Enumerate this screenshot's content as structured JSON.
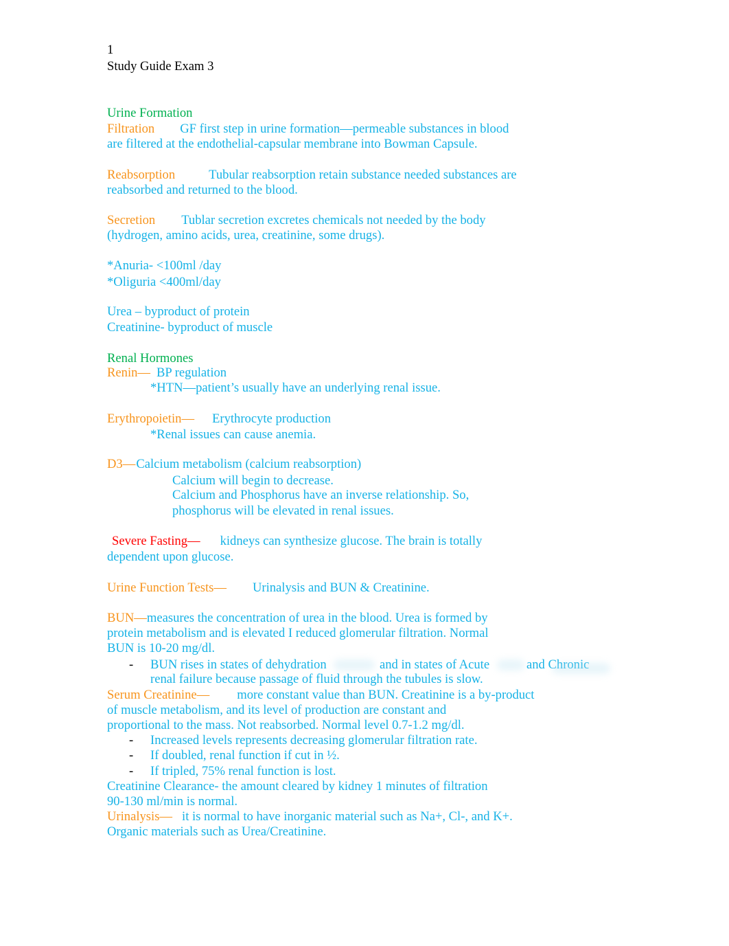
{
  "header": {
    "page_number": "1",
    "title": "Study Guide Exam 3"
  },
  "colors": {
    "heading": "#00b050",
    "term": "#f7941d",
    "body": "#16b2e6",
    "alert": "#ff0000"
  },
  "urine_formation": {
    "heading": "Urine Formation",
    "filtration": {
      "term": "Filtration",
      "line1": "GF first step in urine formation—permeable substances in blood",
      "line2": "are filtered at the endothelial-capsular membrane into Bowman Capsule."
    },
    "reabsorption": {
      "term": "Reabsorption",
      "line1": "Tubular reabsorption retain substance needed substances are",
      "line2": "reabsorbed and returned to the blood."
    },
    "secretion": {
      "term": "Secretion",
      "line1": "Tublar secretion excretes chemicals not needed by the body",
      "line2": "(hydrogen, amino acids, urea, creatinine, some drugs)."
    },
    "anuria": "*Anuria- <100ml /day",
    "oliguria": "*Oliguria <400ml/day",
    "urea": "Urea – byproduct of protein",
    "creatinine": "Creatinine- byproduct of muscle"
  },
  "renal_hormones": {
    "heading": "Renal Hormones",
    "renin": {
      "term": "Renin—",
      "text": "BP regulation",
      "note": "*HTN—patient’s usually have an underlying renal issue."
    },
    "erythropoietin": {
      "term": "Erythropoietin—",
      "text": "Erythrocyte production",
      "note": "*Renal issues can cause anemia."
    },
    "d3": {
      "term": "D3—",
      "text": "Calcium metabolism (calcium reabsorption)",
      "notes": [
        "Calcium will begin to decrease.",
        "Calcium and Phosphorus have an inverse relationship. So,",
        "phosphorus will be elevated in renal issues."
      ]
    },
    "fasting": {
      "term": "Severe Fasting—",
      "line1": "kidneys can synthesize glucose. The brain is totally",
      "line2": "dependent upon glucose."
    }
  },
  "function_tests": {
    "intro": {
      "term": "Urine Function Tests—",
      "text": "Urinalysis and BUN & Creatinine."
    },
    "bun": {
      "term": "BUN—",
      "line1": "measures the concentration of urea in the blood. Urea is formed by",
      "line2": "protein metabolism and is elevated I reduced glomerular filtration. Normal",
      "line3": "BUN is 10-20 mg/dl.",
      "bullet_marker": "-",
      "bullet_a": "BUN rises in states of dehydration",
      "bullet_b": "and in states of Acute",
      "bullet_c": "and Chronic",
      "bullet_line2": "renal failure because passage of fluid through the tubules is slow."
    },
    "serum_creatinine": {
      "term": "Serum Creatinine—",
      "line1": "more constant value than BUN. Creatinine is a by-product",
      "line2": "of muscle metabolism, and its level of production are constant and",
      "line3": "proportional to the mass. Not reabsorbed. Normal level 0.7-1.2 mg/dl.",
      "bullets": [
        "Increased levels represents decreasing glomerular filtration rate.",
        "If doubled, renal function if cut in ½.",
        "If tripled, 75% renal function is lost."
      ]
    },
    "clearance": {
      "line1": "Creatinine Clearance- the amount cleared by kidney 1 minutes of filtration",
      "line2": "90-130 ml/min is normal."
    },
    "urinalysis": {
      "term": "Urinalysis—",
      "line1": "it is normal to have inorganic material such as Na+, Cl-, and K+.",
      "line2": "Organic materials such as Urea/Creatinine."
    }
  }
}
